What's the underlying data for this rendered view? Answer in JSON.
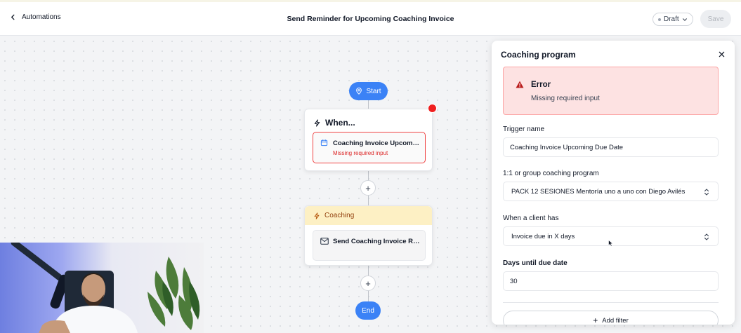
{
  "header": {
    "back_label": "Automations",
    "title": "Send Reminder for Upcoming Coaching Invoice",
    "status_label": "Draft",
    "save_label": "Save"
  },
  "flow": {
    "start_label": "Start",
    "end_label": "End",
    "plus_label": "+",
    "trigger_card": {
      "heading": "When...",
      "item_title": "Coaching Invoice Upcoming Due Date",
      "item_error": "Missing required input"
    },
    "action_card": {
      "heading": "Coaching",
      "item_title": "Send Coaching Invoice Reminder"
    }
  },
  "panel": {
    "title": "Coaching program",
    "alert": {
      "title": "Error",
      "message": "Missing required input"
    },
    "fields": {
      "trigger_name_label": "Trigger name",
      "trigger_name_value": "Coaching Invoice Upcoming Due Date",
      "program_label": "1:1 or group coaching program",
      "program_value": "PACK 12 SESIONES Mentoría uno a uno con Diego Avilés",
      "condition_label": "When a client has",
      "condition_value": "Invoice due in X days",
      "days_label": "Days until due date",
      "days_value": "30"
    },
    "add_filter_label": "Add filter"
  },
  "colors": {
    "accent": "#3b82f6",
    "error": "#ef4444",
    "error_bg": "#fde2e2",
    "coaching_header": "#fdf0c4"
  },
  "icons": {
    "back": "chevron-left-icon",
    "start": "map-pin-icon",
    "trigger": "lightning-icon",
    "calendar": "calendar-icon",
    "mail": "mail-icon",
    "warning": "warning-triangle-icon",
    "close": "close-icon",
    "select": "chevron-up-down-icon"
  }
}
